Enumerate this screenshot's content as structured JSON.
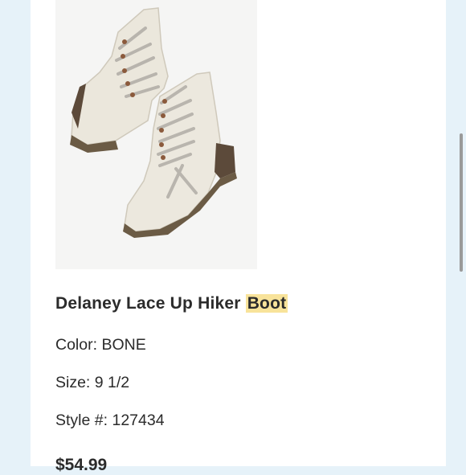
{
  "product": {
    "title_main": "Delaney Lace Up Hiker",
    "title_highlight": "Boot",
    "color_label": "Color:",
    "color_value": "BONE",
    "size_label": "Size:",
    "size_value": "9 1/2",
    "style_label": "Style #:",
    "style_value": "127434",
    "price": "$54.99"
  },
  "colors": {
    "page_bg": "#e6f2f9",
    "card_bg": "#ffffff",
    "highlight": "#f8e39a",
    "text": "#2b2b2b"
  },
  "icons": [
    "product-photo-boots"
  ]
}
